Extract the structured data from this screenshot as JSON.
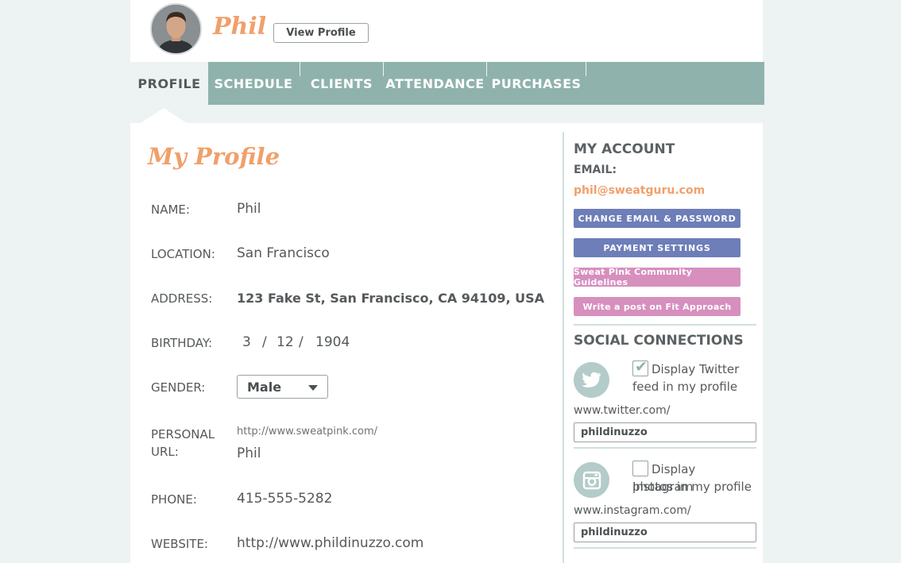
{
  "header": {
    "username": "Phil",
    "view_profile_label": "View Profile"
  },
  "nav": {
    "tabs": [
      {
        "label": "PROFILE",
        "active": true
      },
      {
        "label": "SCHEDULE",
        "active": false
      },
      {
        "label": "CLIENTS",
        "active": false
      },
      {
        "label": "ATTENDANCE",
        "active": false
      },
      {
        "label": "PURCHASES",
        "active": false
      }
    ]
  },
  "profile": {
    "title": "My Profile",
    "name": {
      "label": "NAME:",
      "value": "Phil"
    },
    "location": {
      "label": "LOCATION:",
      "value": "San Francisco"
    },
    "address": {
      "label": "ADDRESS:",
      "value": "123 Fake St,  San Francisco, CA 94109, USA"
    },
    "birthday": {
      "label": "BIRTHDAY:",
      "month": "3",
      "day": "12",
      "year": "1904",
      "separator": "/"
    },
    "gender": {
      "label": "GENDER:",
      "value": "Male"
    },
    "personal_url": {
      "label_line1": "PERSONAL",
      "label_line2": "URL:",
      "prefix": "http://www.sweatpink.com/",
      "value": "Phil"
    },
    "phone": {
      "label": "PHONE:",
      "value": "415-555-5282"
    },
    "website": {
      "label": "WEBSITE:",
      "value": "http://www.phildinuzzo.com"
    }
  },
  "account": {
    "heading": "MY ACCOUNT",
    "email_label": "EMAIL:",
    "email": "phil@sweatguru.com",
    "buttons": {
      "change_email": "CHANGE EMAIL & PASSWORD",
      "payment": "PAYMENT SETTINGS",
      "guidelines": "Sweat Pink Community Guidelines",
      "write_post": "Write a post on Fit Approach"
    },
    "colors": {
      "accent": "#f0a06a",
      "nav": "#8fb2ad",
      "button_blue": "#6d7eb8",
      "button_pink": "#d78fbe"
    }
  },
  "social": {
    "heading": "SOCIAL CONNECTIONS",
    "twitter": {
      "icon": "twitter-bird-icon",
      "checked": true,
      "check_line1": "Display Twitter",
      "check_line2": "feed in my profile",
      "prefix": "www.twitter.com/",
      "handle": "phildinuzzo"
    },
    "instagram": {
      "icon": "instagram-camera-icon",
      "checked": false,
      "check_line1": "Display Instagram",
      "check_line2": "photos in my profile",
      "prefix": "www.instagram.com/",
      "handle": "phildinuzzo"
    }
  }
}
